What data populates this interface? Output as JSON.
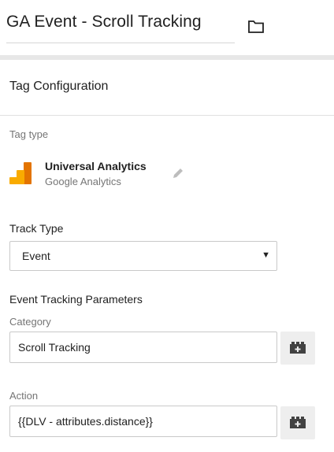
{
  "header": {
    "tag_name": "GA Event - Scroll Tracking",
    "folder_icon": "folder-icon"
  },
  "tag_configuration": {
    "title": "Tag Configuration",
    "tag_type_label": "Tag type",
    "tag_type": {
      "name": "Universal Analytics",
      "vendor": "Google Analytics",
      "logo_icon": "google-analytics-logo-icon",
      "edit_icon": "pencil-icon"
    },
    "track_type": {
      "label": "Track Type",
      "selected": "Event"
    },
    "event_tracking_parameters": {
      "label": "Event Tracking Parameters",
      "category": {
        "label": "Category",
        "value": "Scroll Tracking",
        "variable_icon": "variable-brick-icon"
      },
      "action": {
        "label": "Action",
        "value": "{{DLV - attributes.distance}}",
        "variable_icon": "variable-brick-icon"
      }
    }
  },
  "colors": {
    "logo_orange_dark": "#e37400",
    "logo_orange_light": "#f9ab00",
    "divider": "#e7e7e7",
    "variable_button_bg": "#eeeeee"
  }
}
